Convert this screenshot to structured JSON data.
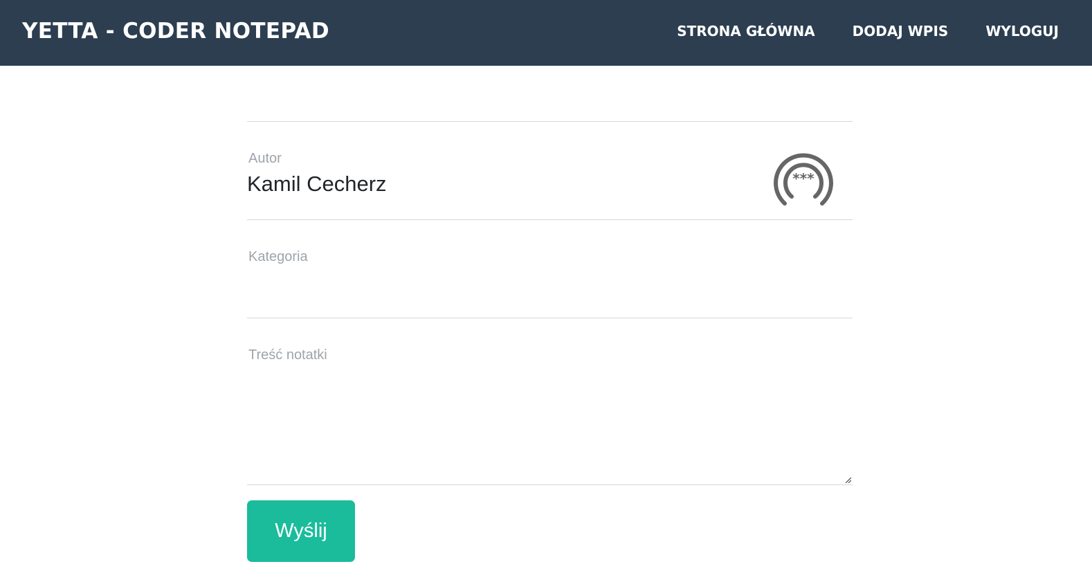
{
  "navbar": {
    "brand": "YETTA - CODER NOTEPAD",
    "links": [
      {
        "label": "STRONA GŁÓWNA"
      },
      {
        "label": "DODAJ WPIS"
      },
      {
        "label": "WYLOGUJ"
      }
    ],
    "background": "#2c3e50"
  },
  "form": {
    "author_label": "Autor",
    "author_value": "Kamil Cecherz",
    "category_label": "Kategoria",
    "category_value": "",
    "content_label": "Treść notatki",
    "content_value": "",
    "password_manager_icon": "password-dots-icon",
    "submit_label": "Wyślij",
    "submit_color": "#1abc9c"
  }
}
